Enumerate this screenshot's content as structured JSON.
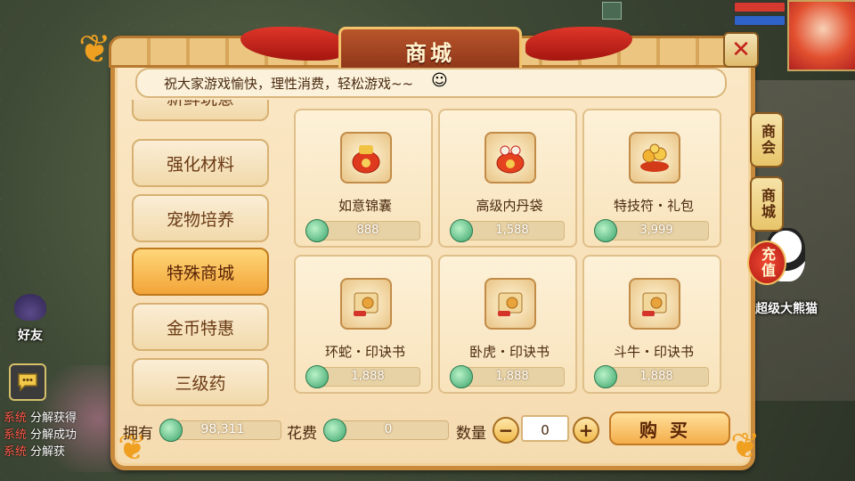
{
  "dialog": {
    "title": "商城",
    "notice": "祝大家游戏愉快，理性消费，轻松游戏~~",
    "close_icon": "close-icon"
  },
  "categories": [
    {
      "label": "新鲜玩意",
      "active": false
    },
    {
      "label": "强化材料",
      "active": false
    },
    {
      "label": "宠物培养",
      "active": false
    },
    {
      "label": "特殊商城",
      "active": true
    },
    {
      "label": "金币特惠",
      "active": false
    },
    {
      "label": "三级药",
      "active": false
    }
  ],
  "items": [
    {
      "name": "如意锦囊",
      "price": "888",
      "icon": "lucky-bag-icon"
    },
    {
      "name": "高级内丹袋",
      "price": "1,588",
      "icon": "pill-bag-icon"
    },
    {
      "name": "特技符・礼包",
      "price": "3,999",
      "icon": "gift-pack-icon"
    },
    {
      "name": "环蛇・印诀书",
      "price": "1,888",
      "icon": "scroll-book-icon"
    },
    {
      "name": "卧虎・印诀书",
      "price": "1,888",
      "icon": "scroll-book-icon"
    },
    {
      "name": "斗牛・印诀书",
      "price": "1,888",
      "icon": "scroll-book-icon"
    }
  ],
  "footer": {
    "owned_label": "拥有",
    "owned_value": "98,311",
    "cost_label": "花费",
    "cost_value": "0",
    "qty_label": "数量",
    "qty_value": "0",
    "minus": "−",
    "plus": "+",
    "buy_label": "购买"
  },
  "side_tabs": {
    "guild_shop": "商会",
    "mall": "商城",
    "recharge": "充值"
  },
  "hud": {
    "friend_label": "好友",
    "panda_name": "超级大熊猫",
    "chat": [
      {
        "tag": "系统",
        "text": "分解获得"
      },
      {
        "tag": "系统",
        "text": "分解成功"
      },
      {
        "tag": "系统",
        "text": "分解获"
      }
    ]
  },
  "colors": {
    "panel": "#f5dbb0",
    "border": "#c98a3c",
    "accent_red": "#c3221a",
    "active_tab": "#f2a437",
    "currency": "#3aa36b"
  }
}
